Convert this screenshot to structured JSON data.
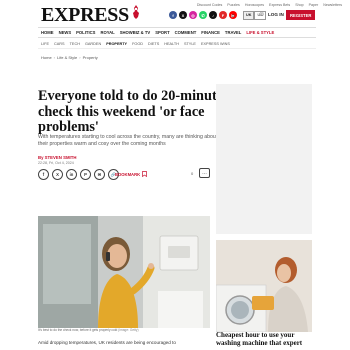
{
  "header": {
    "logo_text": "EXPRESS",
    "util_links": [
      "Discount Codes",
      "Puzzles",
      "Horoscopes",
      "Express Bets",
      "Shop",
      "Paper",
      "Newsletters"
    ],
    "socials": [
      {
        "name": "facebook",
        "color": "#3b5998",
        "glyph": "f"
      },
      {
        "name": "x",
        "color": "#111111",
        "glyph": "X"
      },
      {
        "name": "instagram",
        "color": "#d6249f",
        "glyph": "◎"
      },
      {
        "name": "whatsapp",
        "color": "#25d366",
        "glyph": "✆"
      },
      {
        "name": "tiktok",
        "color": "#111111",
        "glyph": "♪"
      },
      {
        "name": "flipboard",
        "color": "#e12828",
        "glyph": "F"
      },
      {
        "name": "youtube",
        "color": "#ff0000",
        "glyph": "▶"
      }
    ],
    "region_uk": "UK",
    "region_us": "US",
    "login_label": "LOG IN",
    "register_label": "REGISTER"
  },
  "main_nav": [
    {
      "label": "HOME",
      "red": false
    },
    {
      "label": "NEWS",
      "red": false
    },
    {
      "label": "POLITICS",
      "red": false
    },
    {
      "label": "ROYAL",
      "red": false
    },
    {
      "label": "SHOWBIZ & TV",
      "red": false
    },
    {
      "label": "SPORT",
      "red": false
    },
    {
      "label": "COMMENT",
      "red": false
    },
    {
      "label": "FINANCE",
      "red": false
    },
    {
      "label": "TRAVEL",
      "red": false
    },
    {
      "label": "LIFE & STYLE",
      "red": true
    }
  ],
  "sub_nav": [
    {
      "label": "LIFE",
      "active": false
    },
    {
      "label": "CARS",
      "active": false
    },
    {
      "label": "TECH",
      "active": false
    },
    {
      "label": "GARDEN",
      "active": false
    },
    {
      "label": "PROPERTY",
      "active": true
    },
    {
      "label": "FOOD",
      "active": false
    },
    {
      "label": "DIETS",
      "active": false
    },
    {
      "label": "HEALTH",
      "active": false
    },
    {
      "label": "STYLE",
      "active": false
    },
    {
      "label": "EXPRESS WINS",
      "active": false
    }
  ],
  "breadcrumb": [
    "Home",
    "Life & Style",
    "Property"
  ],
  "article": {
    "headline": "Everyone told to do 20-minute check this weekend 'or face problems'",
    "standfirst": "With temperatures starting to cool across the country, many are thinking about keeping their properties warm and cosy over the coming months",
    "author": "By STEVEN SMITH",
    "date": "22:28, Fri, Oct 4, 2024",
    "bookmark_label": "BOOKMARK",
    "comment_count": "0",
    "caption": "It's best to do the check now, before it gets properly cold",
    "caption_credit": "(Image: Getty)",
    "body_start": "Amid dropping temperatures, UK residents are being encouraged to"
  },
  "share": [
    "f",
    "X",
    "in",
    "P",
    "✉",
    "🔗"
  ],
  "sidebar": {
    "title": "Cheapest hour to use your washing machine that expert"
  }
}
